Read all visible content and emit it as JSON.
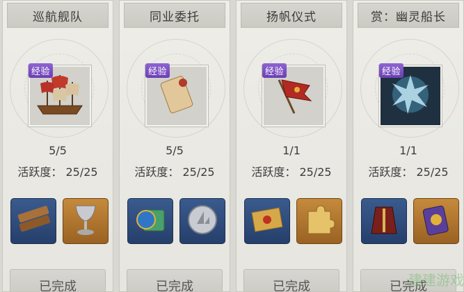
{
  "quests": [
    {
      "title": "巡航舰队",
      "badge": "经验",
      "progress": "5/5",
      "activity_label": "活跃度：",
      "activity_value": "25/25",
      "status": "已完成",
      "icon": "ship-icon",
      "rewards": [
        "wood-planks-icon",
        "silver-chalice-icon"
      ]
    },
    {
      "title": "同业委托",
      "badge": "经验",
      "progress": "5/5",
      "activity_label": "活跃度：",
      "activity_value": "25/25",
      "status": "已完成",
      "icon": "scroll-icon",
      "rewards": [
        "map-globe-icon",
        "silver-coin-icon"
      ]
    },
    {
      "title": "扬帆仪式",
      "badge": "经验",
      "progress": "1/1",
      "activity_label": "活跃度：",
      "activity_value": "25/25",
      "status": "已完成",
      "icon": "banner-flag-icon",
      "rewards": [
        "sealed-envelope-icon",
        "puzzle-piece-icon"
      ]
    },
    {
      "title": "赏：幽灵船长",
      "badge": "经验",
      "progress": "1/1",
      "activity_label": "活跃度：",
      "activity_value": "25/25",
      "status": "已完成",
      "icon": "ghost-captain-icon",
      "rewards": [
        "captain-coat-icon",
        "shield-cards-icon"
      ]
    }
  ],
  "watermark": "建建游戏"
}
